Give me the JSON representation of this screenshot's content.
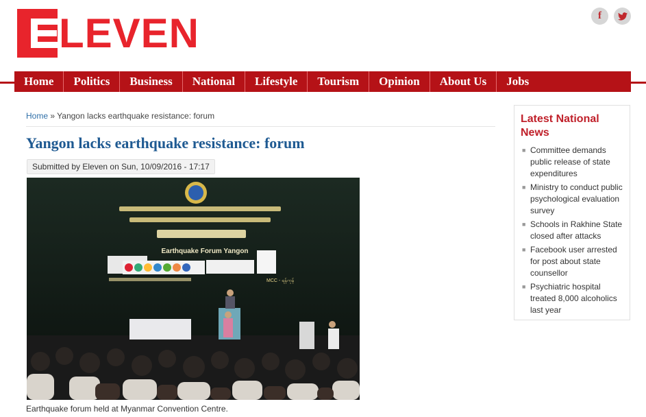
{
  "brand": {
    "logo_text": "LEVEN",
    "accent_color": "#e8242c",
    "nav_color": "#b51217"
  },
  "social": [
    {
      "icon": "facebook-icon",
      "glyph": "f"
    },
    {
      "icon": "twitter-icon",
      "glyph": "t"
    }
  ],
  "nav": {
    "items": [
      "Home",
      "Politics",
      "Business",
      "National",
      "Lifestyle",
      "Tourism",
      "Opinion",
      "About Us",
      "Jobs"
    ]
  },
  "breadcrumb": {
    "home": "Home",
    "separator": "»",
    "current": "Yangon lacks earthquake resistance: forum"
  },
  "article": {
    "title": "Yangon lacks earthquake resistance: forum",
    "submitted": "Submitted by Eleven on Sun, 10/09/2016 - 17:17",
    "image_text": {
      "banner_en": "Earthquake Forum Yangon",
      "banner_right": "MCC - ရန်ကုန်"
    },
    "caption": "Earthquake forum held at Myanmar Convention Centre."
  },
  "sidebar": {
    "title": "Latest National News",
    "items": [
      "Committee demands public release of state expenditures",
      "Ministry to conduct public psychological evaluation survey",
      "Schools in Rakhine State closed after attacks",
      "Facebook user arrested for post about state counsellor",
      "Psychiatric hospital treated 8,000 alcoholics last year"
    ]
  }
}
